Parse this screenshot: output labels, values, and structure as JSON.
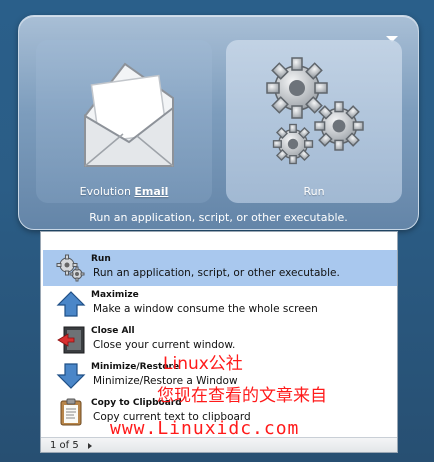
{
  "panel": {
    "tiles": [
      {
        "label_prefix": "Evolution ",
        "label_accel": "Email",
        "icon": "envelope-icon"
      },
      {
        "label": "Run",
        "icon": "gears-icon"
      }
    ],
    "caption": "Run an application, script, or other executable."
  },
  "list": {
    "items": [
      {
        "title": "Run",
        "desc": "Run an application, script, or other executable.",
        "icon": "gears-icon",
        "selected": true
      },
      {
        "title": "Maximize",
        "desc": "Make a window consume the whole screen",
        "icon": "arrow-up-icon"
      },
      {
        "title": "Close All",
        "desc": "Close your current window.",
        "icon": "close-window-icon"
      },
      {
        "title": "Minimize/Restore",
        "desc": "Minimize/Restore a Window",
        "icon": "arrow-down-icon"
      },
      {
        "title": "Copy to Clipboard",
        "desc": "Copy current text to clipboard",
        "icon": "clipboard-icon"
      }
    ],
    "pager": "1 of 5"
  },
  "watermark": {
    "line1": "Linux公社",
    "line2": "您现在查看的文章来自",
    "line3": "www.Linuxidc.com"
  },
  "colors": {
    "background": "#2b5d86",
    "selection": "#a9c8ee",
    "watermark": "#ff1a1a"
  }
}
